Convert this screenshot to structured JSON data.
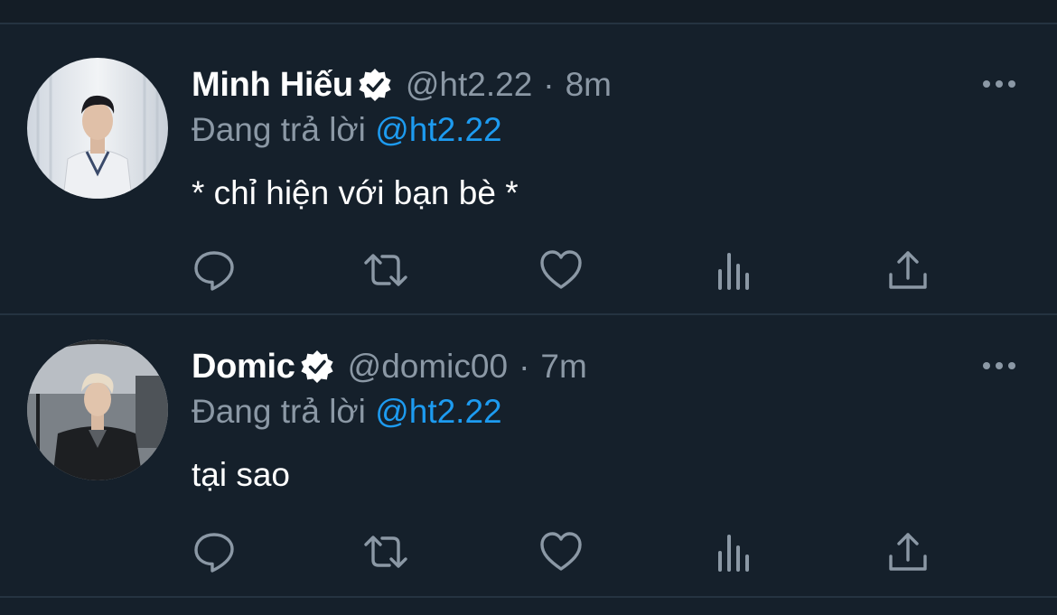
{
  "tweets": [
    {
      "author_name": "Minh Hiếu",
      "verified": true,
      "handle": "@ht2.22",
      "separator": "·",
      "time": "8m",
      "replying_prefix": "Đang trả lời",
      "replying_to": "@ht2.22",
      "text": "* chỉ hiện với bạn bè *",
      "actions": [
        "reply-icon",
        "retweet-icon",
        "like-icon",
        "analytics-icon",
        "share-icon"
      ]
    },
    {
      "author_name": "Domic",
      "verified": true,
      "handle": "@domic00",
      "separator": "·",
      "time": "7m",
      "replying_prefix": "Đang trả lời",
      "replying_to": "@ht2.22",
      "text": "tại sao",
      "actions": [
        "reply-icon",
        "retweet-icon",
        "like-icon",
        "analytics-icon",
        "share-icon"
      ]
    }
  ],
  "colors": {
    "background": "#15202b",
    "divider": "#253341",
    "secondary_text": "#8b98a5",
    "mention": "#1d9bf0",
    "primary_text": "#ffffff"
  }
}
